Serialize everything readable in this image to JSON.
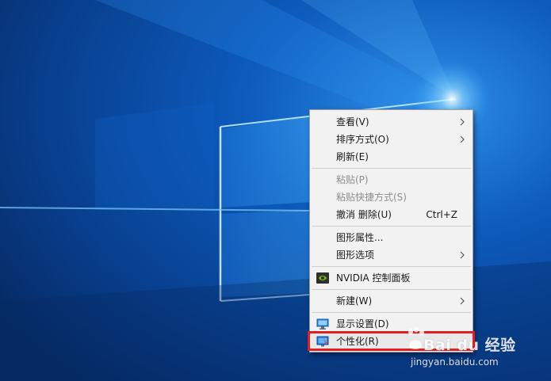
{
  "desktop": {
    "colors": {
      "bg_dark": "#0a2f6a",
      "bg_mid": "#0b57b8",
      "glow": "#3fb4ff"
    }
  },
  "context_menu": {
    "groups": [
      [
        {
          "label": "查看(V)",
          "submenu": true,
          "enabled": true,
          "icon": ""
        },
        {
          "label": "排序方式(O)",
          "submenu": true,
          "enabled": true,
          "icon": ""
        },
        {
          "label": "刷新(E)",
          "submenu": false,
          "enabled": true,
          "icon": ""
        }
      ],
      [
        {
          "label": "粘贴(P)",
          "submenu": false,
          "enabled": false,
          "icon": ""
        },
        {
          "label": "粘贴快捷方式(S)",
          "submenu": false,
          "enabled": false,
          "icon": ""
        },
        {
          "label": "撤消 删除(U)",
          "shortcut": "Ctrl+Z",
          "submenu": false,
          "enabled": true,
          "icon": ""
        }
      ],
      [
        {
          "label": "图形属性...",
          "submenu": false,
          "enabled": true,
          "icon": ""
        },
        {
          "label": "图形选项",
          "submenu": true,
          "enabled": true,
          "icon": ""
        }
      ],
      [
        {
          "label": "NVIDIA 控制面板",
          "submenu": false,
          "enabled": true,
          "icon": "nvidia-icon"
        }
      ],
      [
        {
          "label": "新建(W)",
          "submenu": true,
          "enabled": true,
          "icon": ""
        }
      ],
      [
        {
          "label": "显示设置(D)",
          "submenu": false,
          "enabled": true,
          "icon": "display-settings-icon"
        },
        {
          "label": "个性化(R)",
          "submenu": false,
          "enabled": true,
          "icon": "personalize-icon",
          "highlighted": true
        }
      ]
    ]
  },
  "watermark": {
    "logo_text": "Bai du 经验",
    "url": "jingyan.baidu.com"
  }
}
